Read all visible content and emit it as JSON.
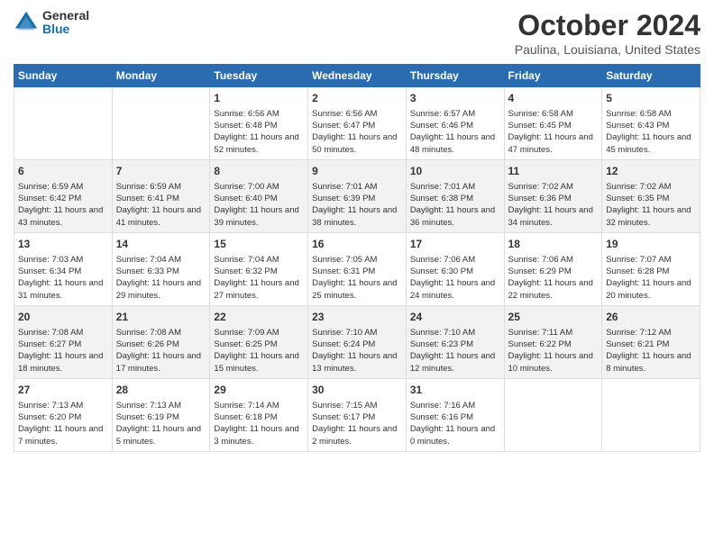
{
  "logo": {
    "general": "General",
    "blue": "Blue"
  },
  "header": {
    "month": "October 2024",
    "location": "Paulina, Louisiana, United States"
  },
  "days_of_week": [
    "Sunday",
    "Monday",
    "Tuesday",
    "Wednesday",
    "Thursday",
    "Friday",
    "Saturday"
  ],
  "weeks": [
    [
      {
        "day": "",
        "info": ""
      },
      {
        "day": "",
        "info": ""
      },
      {
        "day": "1",
        "info": "Sunrise: 6:56 AM\nSunset: 6:48 PM\nDaylight: 11 hours and 52 minutes."
      },
      {
        "day": "2",
        "info": "Sunrise: 6:56 AM\nSunset: 6:47 PM\nDaylight: 11 hours and 50 minutes."
      },
      {
        "day": "3",
        "info": "Sunrise: 6:57 AM\nSunset: 6:46 PM\nDaylight: 11 hours and 48 minutes."
      },
      {
        "day": "4",
        "info": "Sunrise: 6:58 AM\nSunset: 6:45 PM\nDaylight: 11 hours and 47 minutes."
      },
      {
        "day": "5",
        "info": "Sunrise: 6:58 AM\nSunset: 6:43 PM\nDaylight: 11 hours and 45 minutes."
      }
    ],
    [
      {
        "day": "6",
        "info": "Sunrise: 6:59 AM\nSunset: 6:42 PM\nDaylight: 11 hours and 43 minutes."
      },
      {
        "day": "7",
        "info": "Sunrise: 6:59 AM\nSunset: 6:41 PM\nDaylight: 11 hours and 41 minutes."
      },
      {
        "day": "8",
        "info": "Sunrise: 7:00 AM\nSunset: 6:40 PM\nDaylight: 11 hours and 39 minutes."
      },
      {
        "day": "9",
        "info": "Sunrise: 7:01 AM\nSunset: 6:39 PM\nDaylight: 11 hours and 38 minutes."
      },
      {
        "day": "10",
        "info": "Sunrise: 7:01 AM\nSunset: 6:38 PM\nDaylight: 11 hours and 36 minutes."
      },
      {
        "day": "11",
        "info": "Sunrise: 7:02 AM\nSunset: 6:36 PM\nDaylight: 11 hours and 34 minutes."
      },
      {
        "day": "12",
        "info": "Sunrise: 7:02 AM\nSunset: 6:35 PM\nDaylight: 11 hours and 32 minutes."
      }
    ],
    [
      {
        "day": "13",
        "info": "Sunrise: 7:03 AM\nSunset: 6:34 PM\nDaylight: 11 hours and 31 minutes."
      },
      {
        "day": "14",
        "info": "Sunrise: 7:04 AM\nSunset: 6:33 PM\nDaylight: 11 hours and 29 minutes."
      },
      {
        "day": "15",
        "info": "Sunrise: 7:04 AM\nSunset: 6:32 PM\nDaylight: 11 hours and 27 minutes."
      },
      {
        "day": "16",
        "info": "Sunrise: 7:05 AM\nSunset: 6:31 PM\nDaylight: 11 hours and 25 minutes."
      },
      {
        "day": "17",
        "info": "Sunrise: 7:06 AM\nSunset: 6:30 PM\nDaylight: 11 hours and 24 minutes."
      },
      {
        "day": "18",
        "info": "Sunrise: 7:06 AM\nSunset: 6:29 PM\nDaylight: 11 hours and 22 minutes."
      },
      {
        "day": "19",
        "info": "Sunrise: 7:07 AM\nSunset: 6:28 PM\nDaylight: 11 hours and 20 minutes."
      }
    ],
    [
      {
        "day": "20",
        "info": "Sunrise: 7:08 AM\nSunset: 6:27 PM\nDaylight: 11 hours and 18 minutes."
      },
      {
        "day": "21",
        "info": "Sunrise: 7:08 AM\nSunset: 6:26 PM\nDaylight: 11 hours and 17 minutes."
      },
      {
        "day": "22",
        "info": "Sunrise: 7:09 AM\nSunset: 6:25 PM\nDaylight: 11 hours and 15 minutes."
      },
      {
        "day": "23",
        "info": "Sunrise: 7:10 AM\nSunset: 6:24 PM\nDaylight: 11 hours and 13 minutes."
      },
      {
        "day": "24",
        "info": "Sunrise: 7:10 AM\nSunset: 6:23 PM\nDaylight: 11 hours and 12 minutes."
      },
      {
        "day": "25",
        "info": "Sunrise: 7:11 AM\nSunset: 6:22 PM\nDaylight: 11 hours and 10 minutes."
      },
      {
        "day": "26",
        "info": "Sunrise: 7:12 AM\nSunset: 6:21 PM\nDaylight: 11 hours and 8 minutes."
      }
    ],
    [
      {
        "day": "27",
        "info": "Sunrise: 7:13 AM\nSunset: 6:20 PM\nDaylight: 11 hours and 7 minutes."
      },
      {
        "day": "28",
        "info": "Sunrise: 7:13 AM\nSunset: 6:19 PM\nDaylight: 11 hours and 5 minutes."
      },
      {
        "day": "29",
        "info": "Sunrise: 7:14 AM\nSunset: 6:18 PM\nDaylight: 11 hours and 3 minutes."
      },
      {
        "day": "30",
        "info": "Sunrise: 7:15 AM\nSunset: 6:17 PM\nDaylight: 11 hours and 2 minutes."
      },
      {
        "day": "31",
        "info": "Sunrise: 7:16 AM\nSunset: 6:16 PM\nDaylight: 11 hours and 0 minutes."
      },
      {
        "day": "",
        "info": ""
      },
      {
        "day": "",
        "info": ""
      }
    ]
  ]
}
